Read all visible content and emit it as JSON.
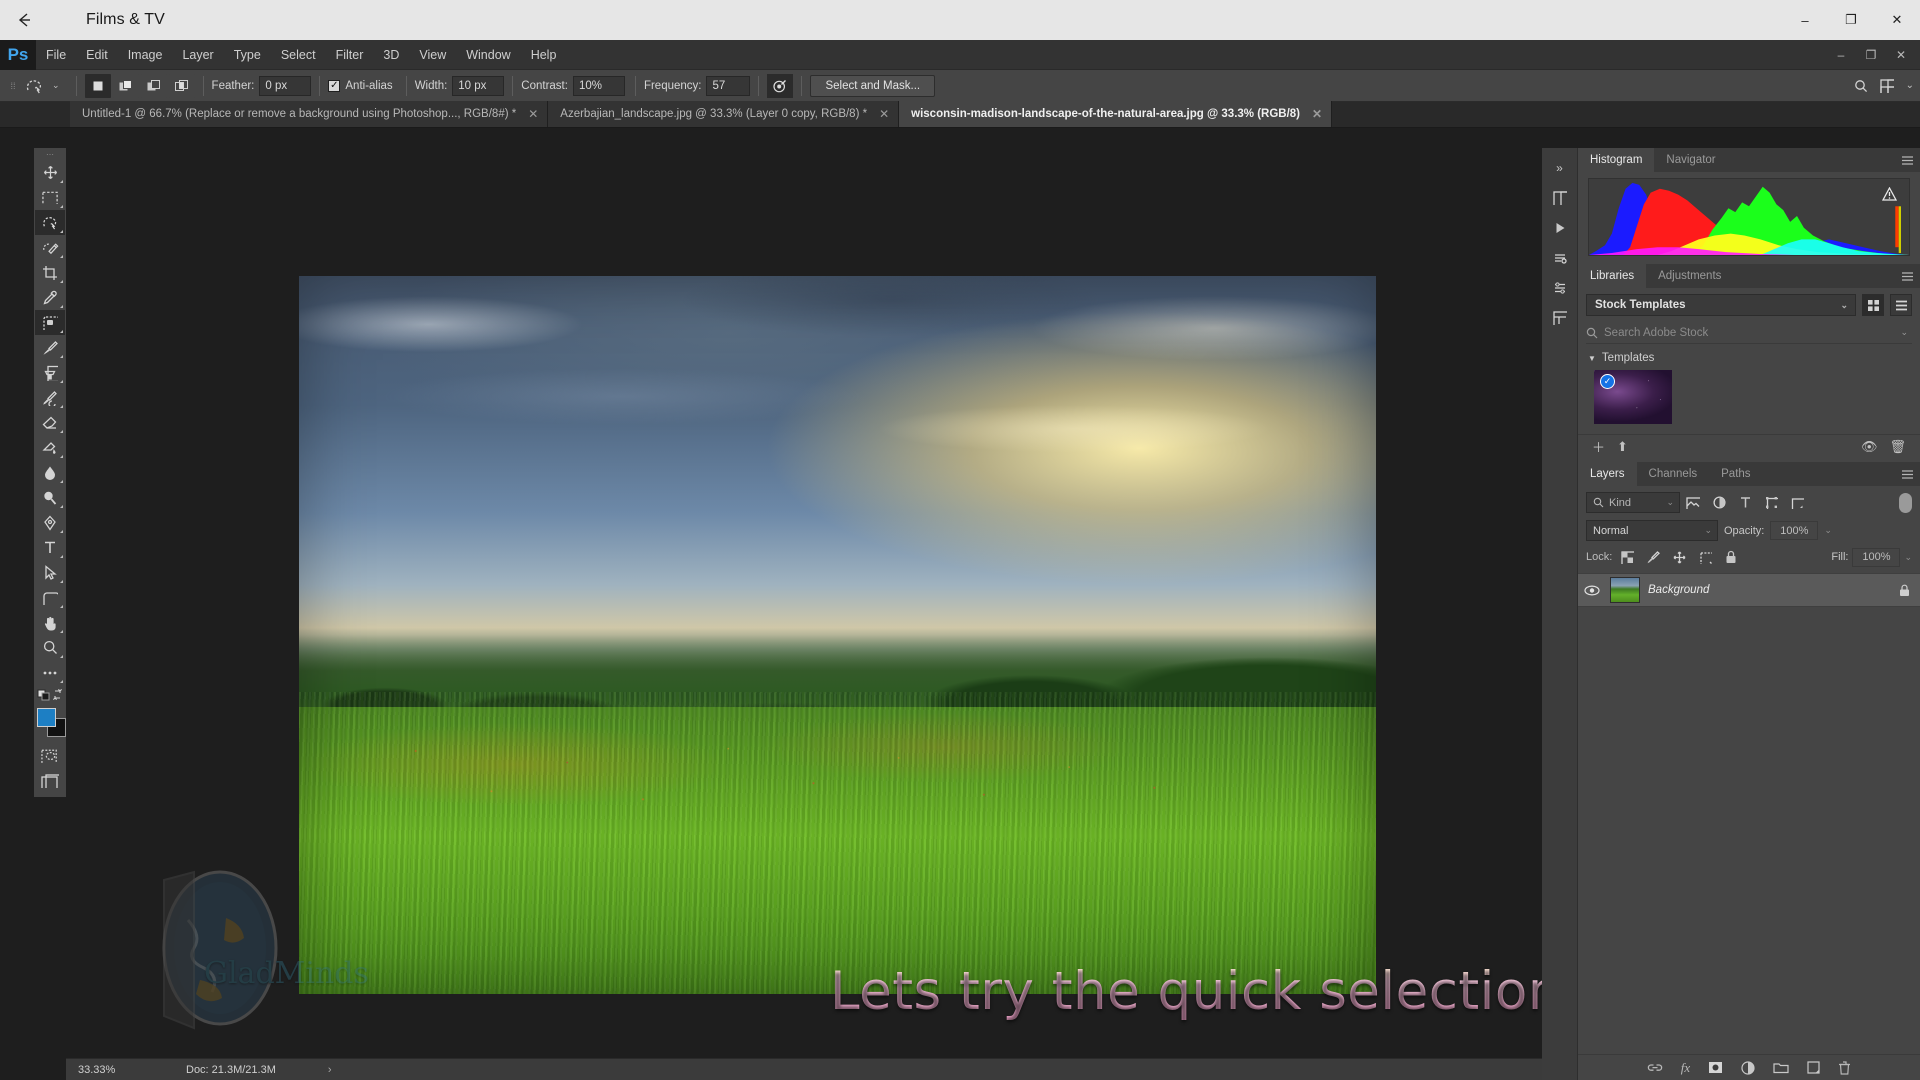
{
  "host": {
    "title": "Films & TV",
    "back_icon": "back-arrow-icon",
    "minimize": "–",
    "maximize": "❐",
    "close": "✕"
  },
  "app": {
    "logo": "Ps",
    "menu": [
      "File",
      "Edit",
      "Image",
      "Layer",
      "Type",
      "Select",
      "Filter",
      "3D",
      "View",
      "Window",
      "Help"
    ],
    "window_controls": [
      "–",
      "❐",
      "✕"
    ]
  },
  "options_bar": {
    "tool_icon": "magnetic-lasso-icon",
    "tool_caret": "⌄",
    "selection_modes": [
      "new-selection",
      "add-to-selection",
      "subtract-from-selection",
      "intersect-with-selection"
    ],
    "active_mode_index": 0,
    "feather_label": "Feather:",
    "feather_value": "0 px",
    "antialias_label": "Anti-alias",
    "antialias_checked": true,
    "width_label": "Width:",
    "width_value": "10 px",
    "contrast_label": "Contrast:",
    "contrast_value": "10%",
    "frequency_label": "Frequency:",
    "frequency_value": "57",
    "pressure_icon": "stylus-pressure-icon",
    "select_and_mask_label": "Select and Mask...",
    "right_icons": [
      "search-icon",
      "workspace-icon",
      "chevron-down-icon"
    ]
  },
  "document_tabs": [
    {
      "label": "Untitled-1 @ 66.7% (Replace or remove a  background using Photoshop..., RGB/8#) *",
      "active": false,
      "close": "✕"
    },
    {
      "label": "Azerbajian_landscape.jpg @ 33.3% (Layer 0 copy, RGB/8) *",
      "active": false,
      "close": "✕"
    },
    {
      "label": "wisconsin-madison-landscape-of-the-natural-area.jpg @ 33.3% (RGB/8)",
      "active": true,
      "close": "✕"
    }
  ],
  "toolbox": {
    "grip": "⋯",
    "tools": [
      {
        "name": "move-tool",
        "active": false
      },
      {
        "name": "rectangular-marquee-tool",
        "active": false
      },
      {
        "name": "lasso-tool",
        "active": true
      },
      {
        "name": "quick-selection-tool",
        "active": false
      },
      {
        "name": "crop-tool",
        "active": false
      },
      {
        "name": "eyedropper-tool",
        "active": false
      },
      {
        "name": "patch-tool",
        "active": true
      },
      {
        "name": "brush-tool",
        "active": false
      },
      {
        "name": "clone-stamp-tool",
        "active": false
      },
      {
        "name": "history-brush-tool",
        "active": false
      },
      {
        "name": "eraser-tool",
        "active": false
      },
      {
        "name": "gradient-tool",
        "active": false
      },
      {
        "name": "blur-tool",
        "active": false
      },
      {
        "name": "dodge-tool",
        "active": false
      },
      {
        "name": "pen-tool",
        "active": false
      },
      {
        "name": "type-tool",
        "active": false
      },
      {
        "name": "path-selection-tool",
        "active": false
      },
      {
        "name": "rectangle-tool",
        "active": false
      },
      {
        "name": "hand-tool",
        "active": false
      },
      {
        "name": "zoom-tool",
        "active": false
      },
      {
        "name": "edit-toolbar-tool",
        "active": false
      }
    ],
    "foreground_color": "#1d7fc4",
    "background_color": "#111111",
    "quick_mask": "quick-mask-icon",
    "screen_mode": "screen-mode-icon"
  },
  "canvas": {
    "caption_text": "Lets try the quick selection tool",
    "watermark_text": "GladMinds",
    "image_alt": "wisconsin madison landscape of the natural area"
  },
  "status_bar": {
    "zoom": "33.33%",
    "doc_label": "Doc: 21.3M/21.3M",
    "arrow": "›"
  },
  "dock": {
    "rail_icons": [
      "panel-expand-icon",
      "play-icon",
      "history-icon",
      "actions-icon",
      "properties-icon"
    ],
    "collapse_icon": "»",
    "histogram": {
      "tabs": [
        {
          "label": "Histogram",
          "active": true
        },
        {
          "label": "Navigator",
          "active": false
        }
      ],
      "menu_icon": "panel-menu-icon",
      "warning_icon": "cached-data-warning-icon"
    },
    "libraries": {
      "tabs": [
        {
          "label": "Libraries",
          "active": true
        },
        {
          "label": "Adjustments",
          "active": false
        }
      ],
      "menu_icon": "panel-menu-icon",
      "selected_library": "Stock Templates",
      "view_grid_icon": "grid-view-icon",
      "view_list_icon": "list-view-icon",
      "search_placeholder": "Search Adobe Stock",
      "group_label": "Templates",
      "group_caret": "▼",
      "asset_selected": true,
      "footer_icons": [
        "add-icon",
        "upload-icon",
        "link-icon",
        "delete-icon"
      ]
    },
    "layers": {
      "tabs": [
        {
          "label": "Layers",
          "active": true
        },
        {
          "label": "Channels",
          "active": false
        },
        {
          "label": "Paths",
          "active": false
        }
      ],
      "menu_icon": "panel-menu-icon",
      "filter_placeholder": "Kind",
      "filter_icons": [
        "filter-pixel-icon",
        "filter-adjustment-icon",
        "filter-type-icon",
        "filter-shape-icon",
        "filter-smart-object-icon"
      ],
      "blend_mode": "Normal",
      "opacity_label": "Opacity:",
      "opacity_value": "100%",
      "lock_label": "Lock:",
      "lock_icons": [
        "lock-transparent-pixels-icon",
        "lock-image-pixels-icon",
        "lock-position-icon",
        "lock-artboard-icon",
        "lock-all-icon"
      ],
      "fill_label": "Fill:",
      "fill_value": "100%",
      "rows": [
        {
          "name": "Background",
          "visible": true,
          "locked": true,
          "eye_icon": "eye-icon",
          "lock_icon": "lock-icon"
        }
      ],
      "footer_icons": [
        "link-layers-icon",
        "layer-style-fx-icon",
        "add-layer-mask-icon",
        "new-fill-adjustment-icon",
        "new-group-icon",
        "new-layer-icon",
        "delete-layer-icon"
      ]
    }
  },
  "chart_data": {
    "type": "histogram",
    "title": "Histogram",
    "channels": [
      "Red",
      "Green",
      "Blue"
    ],
    "note": "RGB composite histogram of the open image, 256 levels, levels 0-255 on x axis"
  }
}
